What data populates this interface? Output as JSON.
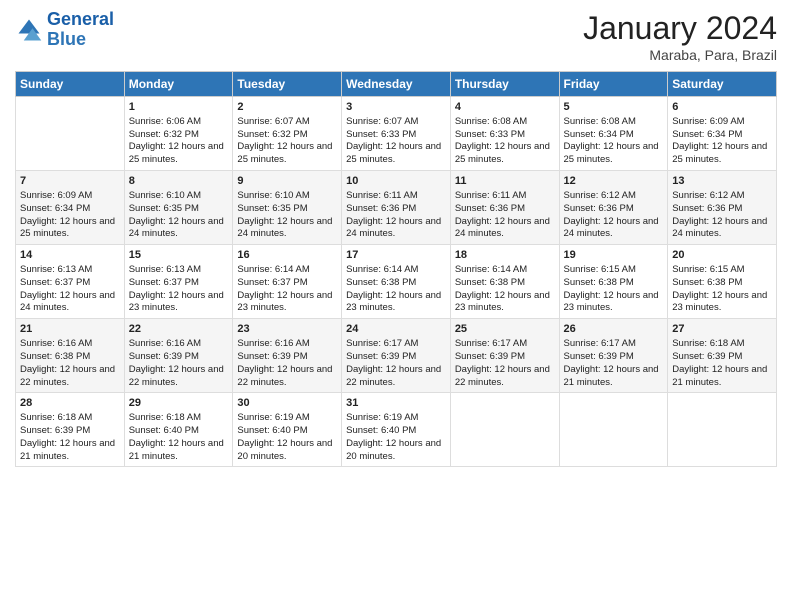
{
  "header": {
    "logo_line1": "General",
    "logo_line2": "Blue",
    "main_title": "January 2024",
    "subtitle": "Maraba, Para, Brazil"
  },
  "days_of_week": [
    "Sunday",
    "Monday",
    "Tuesday",
    "Wednesday",
    "Thursday",
    "Friday",
    "Saturday"
  ],
  "weeks": [
    [
      {
        "day": "",
        "sunrise": "",
        "sunset": "",
        "daylight": ""
      },
      {
        "day": "1",
        "sunrise": "Sunrise: 6:06 AM",
        "sunset": "Sunset: 6:32 PM",
        "daylight": "Daylight: 12 hours and 25 minutes."
      },
      {
        "day": "2",
        "sunrise": "Sunrise: 6:07 AM",
        "sunset": "Sunset: 6:32 PM",
        "daylight": "Daylight: 12 hours and 25 minutes."
      },
      {
        "day": "3",
        "sunrise": "Sunrise: 6:07 AM",
        "sunset": "Sunset: 6:33 PM",
        "daylight": "Daylight: 12 hours and 25 minutes."
      },
      {
        "day": "4",
        "sunrise": "Sunrise: 6:08 AM",
        "sunset": "Sunset: 6:33 PM",
        "daylight": "Daylight: 12 hours and 25 minutes."
      },
      {
        "day": "5",
        "sunrise": "Sunrise: 6:08 AM",
        "sunset": "Sunset: 6:34 PM",
        "daylight": "Daylight: 12 hours and 25 minutes."
      },
      {
        "day": "6",
        "sunrise": "Sunrise: 6:09 AM",
        "sunset": "Sunset: 6:34 PM",
        "daylight": "Daylight: 12 hours and 25 minutes."
      }
    ],
    [
      {
        "day": "7",
        "sunrise": "Sunrise: 6:09 AM",
        "sunset": "Sunset: 6:34 PM",
        "daylight": "Daylight: 12 hours and 25 minutes."
      },
      {
        "day": "8",
        "sunrise": "Sunrise: 6:10 AM",
        "sunset": "Sunset: 6:35 PM",
        "daylight": "Daylight: 12 hours and 24 minutes."
      },
      {
        "day": "9",
        "sunrise": "Sunrise: 6:10 AM",
        "sunset": "Sunset: 6:35 PM",
        "daylight": "Daylight: 12 hours and 24 minutes."
      },
      {
        "day": "10",
        "sunrise": "Sunrise: 6:11 AM",
        "sunset": "Sunset: 6:36 PM",
        "daylight": "Daylight: 12 hours and 24 minutes."
      },
      {
        "day": "11",
        "sunrise": "Sunrise: 6:11 AM",
        "sunset": "Sunset: 6:36 PM",
        "daylight": "Daylight: 12 hours and 24 minutes."
      },
      {
        "day": "12",
        "sunrise": "Sunrise: 6:12 AM",
        "sunset": "Sunset: 6:36 PM",
        "daylight": "Daylight: 12 hours and 24 minutes."
      },
      {
        "day": "13",
        "sunrise": "Sunrise: 6:12 AM",
        "sunset": "Sunset: 6:36 PM",
        "daylight": "Daylight: 12 hours and 24 minutes."
      }
    ],
    [
      {
        "day": "14",
        "sunrise": "Sunrise: 6:13 AM",
        "sunset": "Sunset: 6:37 PM",
        "daylight": "Daylight: 12 hours and 24 minutes."
      },
      {
        "day": "15",
        "sunrise": "Sunrise: 6:13 AM",
        "sunset": "Sunset: 6:37 PM",
        "daylight": "Daylight: 12 hours and 23 minutes."
      },
      {
        "day": "16",
        "sunrise": "Sunrise: 6:14 AM",
        "sunset": "Sunset: 6:37 PM",
        "daylight": "Daylight: 12 hours and 23 minutes."
      },
      {
        "day": "17",
        "sunrise": "Sunrise: 6:14 AM",
        "sunset": "Sunset: 6:38 PM",
        "daylight": "Daylight: 12 hours and 23 minutes."
      },
      {
        "day": "18",
        "sunrise": "Sunrise: 6:14 AM",
        "sunset": "Sunset: 6:38 PM",
        "daylight": "Daylight: 12 hours and 23 minutes."
      },
      {
        "day": "19",
        "sunrise": "Sunrise: 6:15 AM",
        "sunset": "Sunset: 6:38 PM",
        "daylight": "Daylight: 12 hours and 23 minutes."
      },
      {
        "day": "20",
        "sunrise": "Sunrise: 6:15 AM",
        "sunset": "Sunset: 6:38 PM",
        "daylight": "Daylight: 12 hours and 23 minutes."
      }
    ],
    [
      {
        "day": "21",
        "sunrise": "Sunrise: 6:16 AM",
        "sunset": "Sunset: 6:38 PM",
        "daylight": "Daylight: 12 hours and 22 minutes."
      },
      {
        "day": "22",
        "sunrise": "Sunrise: 6:16 AM",
        "sunset": "Sunset: 6:39 PM",
        "daylight": "Daylight: 12 hours and 22 minutes."
      },
      {
        "day": "23",
        "sunrise": "Sunrise: 6:16 AM",
        "sunset": "Sunset: 6:39 PM",
        "daylight": "Daylight: 12 hours and 22 minutes."
      },
      {
        "day": "24",
        "sunrise": "Sunrise: 6:17 AM",
        "sunset": "Sunset: 6:39 PM",
        "daylight": "Daylight: 12 hours and 22 minutes."
      },
      {
        "day": "25",
        "sunrise": "Sunrise: 6:17 AM",
        "sunset": "Sunset: 6:39 PM",
        "daylight": "Daylight: 12 hours and 22 minutes."
      },
      {
        "day": "26",
        "sunrise": "Sunrise: 6:17 AM",
        "sunset": "Sunset: 6:39 PM",
        "daylight": "Daylight: 12 hours and 21 minutes."
      },
      {
        "day": "27",
        "sunrise": "Sunrise: 6:18 AM",
        "sunset": "Sunset: 6:39 PM",
        "daylight": "Daylight: 12 hours and 21 minutes."
      }
    ],
    [
      {
        "day": "28",
        "sunrise": "Sunrise: 6:18 AM",
        "sunset": "Sunset: 6:39 PM",
        "daylight": "Daylight: 12 hours and 21 minutes."
      },
      {
        "day": "29",
        "sunrise": "Sunrise: 6:18 AM",
        "sunset": "Sunset: 6:40 PM",
        "daylight": "Daylight: 12 hours and 21 minutes."
      },
      {
        "day": "30",
        "sunrise": "Sunrise: 6:19 AM",
        "sunset": "Sunset: 6:40 PM",
        "daylight": "Daylight: 12 hours and 20 minutes."
      },
      {
        "day": "31",
        "sunrise": "Sunrise: 6:19 AM",
        "sunset": "Sunset: 6:40 PM",
        "daylight": "Daylight: 12 hours and 20 minutes."
      },
      {
        "day": "",
        "sunrise": "",
        "sunset": "",
        "daylight": ""
      },
      {
        "day": "",
        "sunrise": "",
        "sunset": "",
        "daylight": ""
      },
      {
        "day": "",
        "sunrise": "",
        "sunset": "",
        "daylight": ""
      }
    ]
  ]
}
